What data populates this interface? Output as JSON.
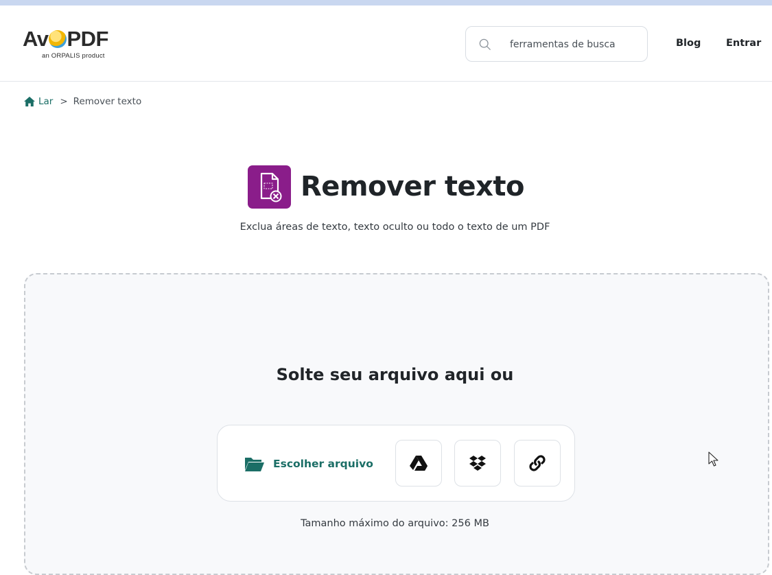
{
  "brand": {
    "logo_text_pre": "Av",
    "logo_text_post": "PDF",
    "logo_tagline": "an ORPALIS product"
  },
  "search": {
    "placeholder": "ferramentas de busca",
    "icon": "search-icon"
  },
  "nav": {
    "blog": "Blog",
    "login": "Entrar"
  },
  "breadcrumb": {
    "home_label": "Lar",
    "separator": ">",
    "current": "Remover texto"
  },
  "tool": {
    "title": "Remover texto",
    "subtitle": "Exclua áreas de texto, texto oculto ou todo o texto de um PDF",
    "icon": "remove-text-icon",
    "icon_color": "#8a1d8a"
  },
  "upload": {
    "drop_title": "Solte seu arquivo aqui ou",
    "choose_file": "Escolher arquivo",
    "sources": [
      "google-drive-icon",
      "dropbox-icon",
      "link-icon"
    ],
    "max_size": "Tamanho máximo do arquivo: 256 MB"
  },
  "colors": {
    "accent": "#1b6e66",
    "dropzone_bg": "#f8f9fb",
    "dropzone_border": "#c7cbd0"
  }
}
